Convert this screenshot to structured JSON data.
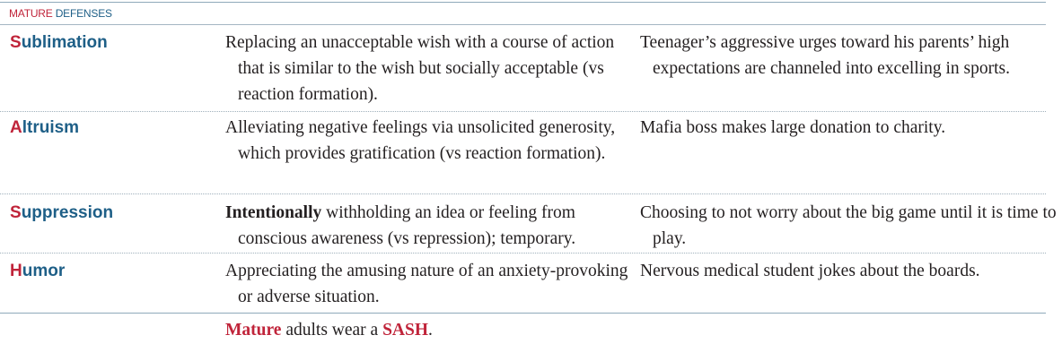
{
  "header": {
    "title_part1": "MATURE",
    "title_part2": "DEFENSES"
  },
  "rows": [
    {
      "term_first": "S",
      "term_rest": "ublimation",
      "definition": "Replacing an unacceptable wish with a course of action that is similar to the wish but socially acceptable (vs reaction formation).",
      "example": "Teenager’s aggressive urges toward his parents’ high expectations are channeled into excelling in sports."
    },
    {
      "term_first": "A",
      "term_rest": "ltruism",
      "definition": "Alleviating negative feelings via unsolicited generosity, which provides gratification (vs reaction formation).",
      "example": "Mafia boss makes large donation to charity."
    },
    {
      "term_first": "S",
      "term_rest": "uppression",
      "definition_bold": "Intentionally",
      "definition": " withholding an idea or feeling from conscious awareness (vs repression); temporary.",
      "example": "Choosing to not worry about the big game until it is time to play."
    },
    {
      "term_first": "H",
      "term_rest": "umor",
      "definition": "Appreciating the amusing nature of an anxiety-provoking or adverse situation.",
      "example": "Nervous medical student jokes about the boards."
    }
  ],
  "mnemonic": {
    "word1": "Mature",
    "mid": " adults wear a ",
    "word2": "SASH",
    "end": "."
  }
}
